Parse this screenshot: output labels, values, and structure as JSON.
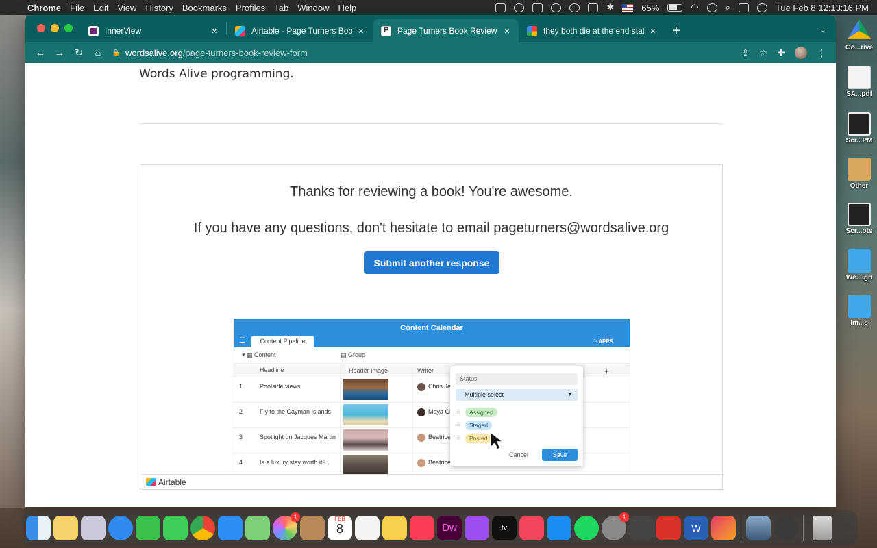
{
  "menubar": {
    "app_name": "Chrome",
    "menus": [
      "File",
      "Edit",
      "View",
      "History",
      "Bookmarks",
      "Profiles",
      "Tab",
      "Window",
      "Help"
    ],
    "battery": "65%",
    "datetime": "Tue Feb 8  12:13:16 PM"
  },
  "browser": {
    "tabs": [
      {
        "title": "InnerView",
        "active": false
      },
      {
        "title": "Airtable - Page Turners Books",
        "active": false
      },
      {
        "title": "Page Turners Book Review Form",
        "active": true
      },
      {
        "title": "they both die at the end stats -",
        "active": false
      }
    ],
    "url_host": "wordsalive.org",
    "url_path": "/page-turners-book-review-form"
  },
  "page": {
    "intro_text": "Words Alive programming.",
    "thanks": "Thanks for reviewing a book! You're awesome.",
    "questions": "If you have any questions, don't hesitate to email pageturners@wordsalive.org",
    "submit_label": "Submit another response",
    "brand": "Airtable"
  },
  "preview": {
    "title": "Content Calendar",
    "tab": "Content Pipeline",
    "apps": "APPS",
    "table_label": "Content",
    "group_label": "Group",
    "columns": [
      "Headline",
      "Header Image",
      "Writer"
    ],
    "rows": [
      {
        "num": "1",
        "headline": "Poolside views",
        "writer": "Chris Je"
      },
      {
        "num": "2",
        "headline": "Fly to the Cayman Islands",
        "writer": "Maya Ch"
      },
      {
        "num": "3",
        "headline": "Spotlight on Jacques Martin",
        "writer": "Beatrice"
      },
      {
        "num": "4",
        "headline": "Is a luxury stay worth it?",
        "writer": "Beatrice"
      }
    ],
    "popup": {
      "field": "Status",
      "type": "Multiple select",
      "options": [
        "Assigned",
        "Staged",
        "Posted"
      ],
      "cancel": "Cancel",
      "save": "Save"
    }
  },
  "desktop": {
    "icons": [
      "Go...rive",
      "SA...pdf",
      "Scr...PM",
      "Other",
      "Scr...ots",
      "We...ign",
      "Im...s"
    ]
  },
  "dock": {
    "calendar_month": "FEB",
    "calendar_day": "8",
    "badges": {
      "photos": "1",
      "settings": "1"
    }
  }
}
